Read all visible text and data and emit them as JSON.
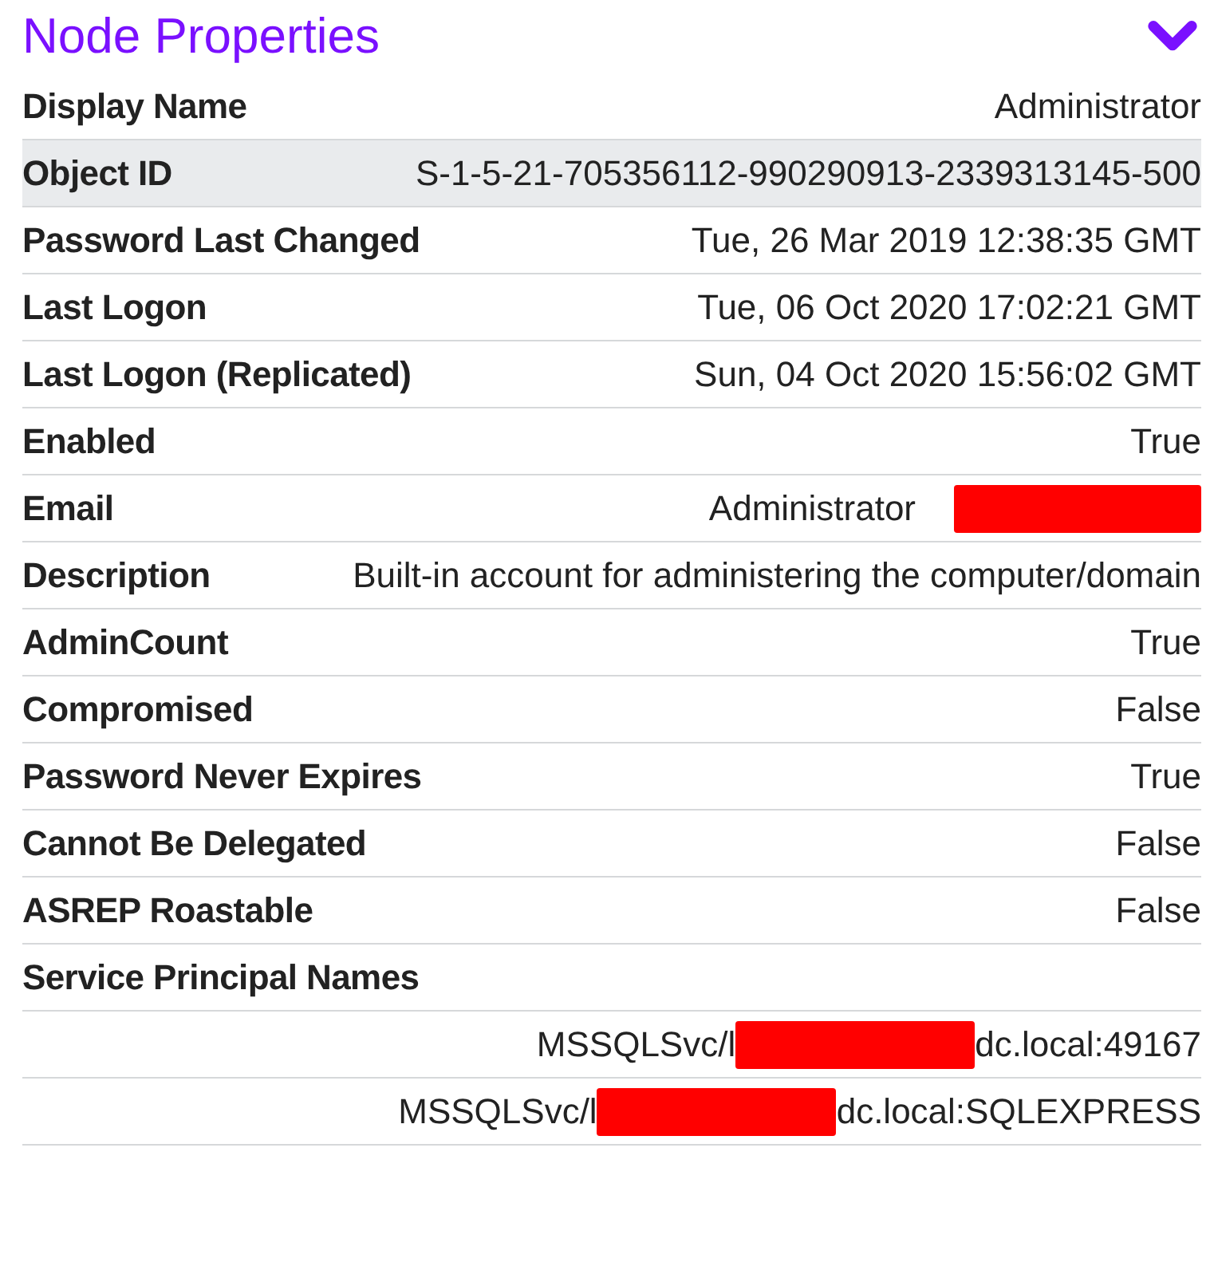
{
  "panel": {
    "title": "Node Properties",
    "expanded": true
  },
  "rows": [
    {
      "kind": "pair",
      "label": "Display Name",
      "value": "Administrator",
      "highlighted": false
    },
    {
      "kind": "pair",
      "label": "Object ID",
      "value": "S-1-5-21-705356112-990290913-2339313145-500",
      "highlighted": true
    },
    {
      "kind": "pair",
      "label": "Password Last Changed",
      "value": "Tue, 26 Mar 2019 12:38:35 GMT",
      "highlighted": false
    },
    {
      "kind": "pair",
      "label": "Last Logon",
      "value": "Tue, 06 Oct 2020 17:02:21 GMT",
      "highlighted": false
    },
    {
      "kind": "pair",
      "label": "Last Logon (Replicated)",
      "value": "Sun, 04 Oct 2020 15:56:02 GMT",
      "highlighted": false
    },
    {
      "kind": "pair",
      "label": "Enabled",
      "value": "True",
      "highlighted": false
    },
    {
      "kind": "pair",
      "label": "Email",
      "value": "Administrator",
      "redacted": true,
      "highlighted": false
    },
    {
      "kind": "pair",
      "label": "Description",
      "value": "Built-in account for administering the computer/domain",
      "highlighted": false
    },
    {
      "kind": "pair",
      "label": "AdminCount",
      "value": "True",
      "highlighted": false
    },
    {
      "kind": "pair",
      "label": "Compromised",
      "value": "False",
      "highlighted": false
    },
    {
      "kind": "pair",
      "label": "Password Never Expires",
      "value": "True",
      "highlighted": false
    },
    {
      "kind": "pair",
      "label": "Cannot Be Delegated",
      "value": "False",
      "highlighted": false
    },
    {
      "kind": "pair",
      "label": "ASREP Roastable",
      "value": "False",
      "highlighted": false
    },
    {
      "kind": "list",
      "label": "Service Principal Names",
      "highlighted": false,
      "items": [
        {
          "prefix": "MSSQLSvc/l",
          "redacted": true,
          "suffix": "dc.local:49167"
        },
        {
          "prefix": "MSSQLSvc/l",
          "redacted": true,
          "suffix": "dc.local:SQLEXPRESS"
        }
      ]
    }
  ]
}
